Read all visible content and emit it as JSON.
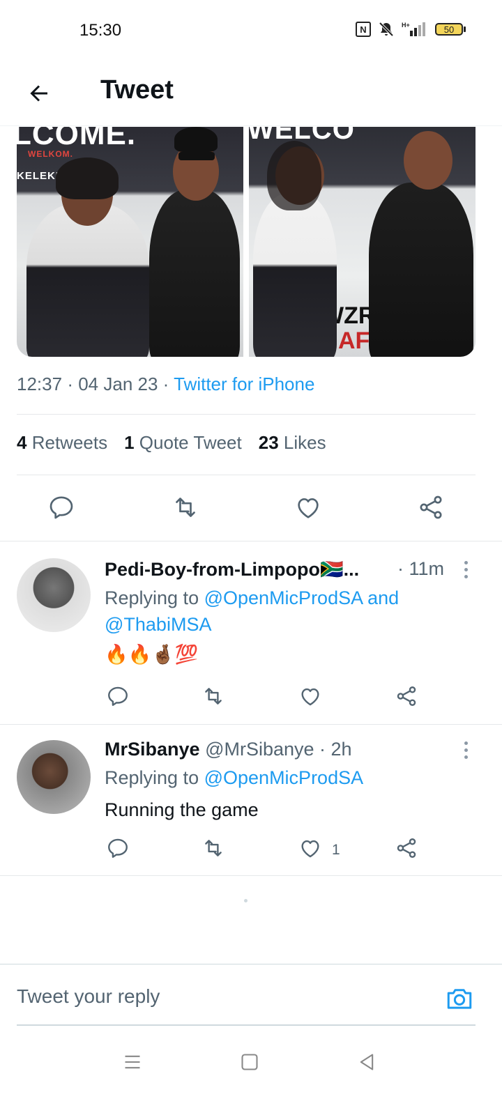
{
  "status": {
    "time": "15:30",
    "nfc_label": "N",
    "battery": "50",
    "network": "H+"
  },
  "header": {
    "title": "Tweet"
  },
  "media": {
    "photo1_banner": "LCOME.",
    "photo1_text1": "WELKOM.",
    "photo1_text2": "KELEKIL",
    "photo2_banner": "WELCO",
    "photo2_brand1": "WZROOM",
    "photo2_brand2": "AFRIKA"
  },
  "tweet": {
    "time": "12:37",
    "date": "04 Jan 23",
    "sep": "·",
    "source": "Twitter for iPhone",
    "stats": {
      "retweets_count": "4",
      "retweets_label": "Retweets",
      "quotes_count": "1",
      "quotes_label": "Quote Tweet",
      "likes_count": "23",
      "likes_label": "Likes"
    }
  },
  "replies": [
    {
      "name": "Pedi-Boy-from-Limpopo🇿🇦...",
      "handle": "",
      "time": "· 11m",
      "replying_prefix": "Replying to",
      "replying_to": "@OpenMicProdSA and",
      "replying_to2": "@ThabiMSA",
      "text": "🔥🔥🤞🏾💯",
      "likes": ""
    },
    {
      "name": "MrSibanye",
      "handle": "@MrSibanye",
      "time": "· 2h",
      "replying_prefix": "Replying to",
      "replying_to": "@OpenMicProdSA",
      "text": "Running the game",
      "likes": "1"
    }
  ],
  "composer": {
    "placeholder": "Tweet your reply"
  },
  "icons": {
    "back": "arrow-left-icon",
    "reply": "comment-icon",
    "retweet": "retweet-icon",
    "like": "heart-icon",
    "share": "share-icon",
    "more": "more-vertical-icon",
    "camera": "camera-icon"
  },
  "colors": {
    "link": "#1d9bf0",
    "secondary_text": "#536471",
    "primary_text": "#0f1419"
  }
}
